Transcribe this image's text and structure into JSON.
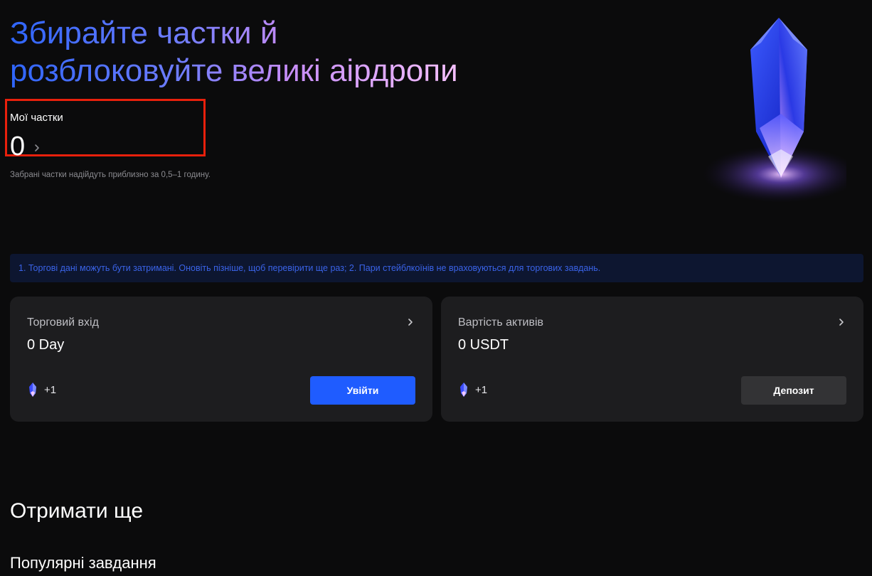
{
  "hero": {
    "title_line1": "Збирайте частки й",
    "title_line2": "розблоковуйте великі аірдропи"
  },
  "shards": {
    "label": "Мої частки",
    "value": "0",
    "note": "Забрані частки надійдуть приблизно за 0,5–1 годину."
  },
  "notice": {
    "text": "1. Торгові дані можуть бути затримані. Оновіть пізніше, щоб перевірити ще раз; 2. Пари стейблкоїнів не враховуються для торгових завдань."
  },
  "cards": [
    {
      "title": "Торговий вхід",
      "value": "0 Day",
      "reward": "+1",
      "button_label": "Увійти",
      "button_icon": "chevron-right-icon"
    },
    {
      "title": "Вартість активів",
      "value": "0 USDT",
      "reward": "+1",
      "button_label": "Депозит",
      "button_icon": "chevron-right-icon"
    }
  ],
  "more": {
    "title": "Отримати ще",
    "popular_tasks": "Популярні завдання"
  },
  "colors": {
    "accent": "#1f5cff",
    "highlight_box": "#e8200c",
    "notice_text": "#3a63e8",
    "card_bg": "#1d1d1f"
  }
}
